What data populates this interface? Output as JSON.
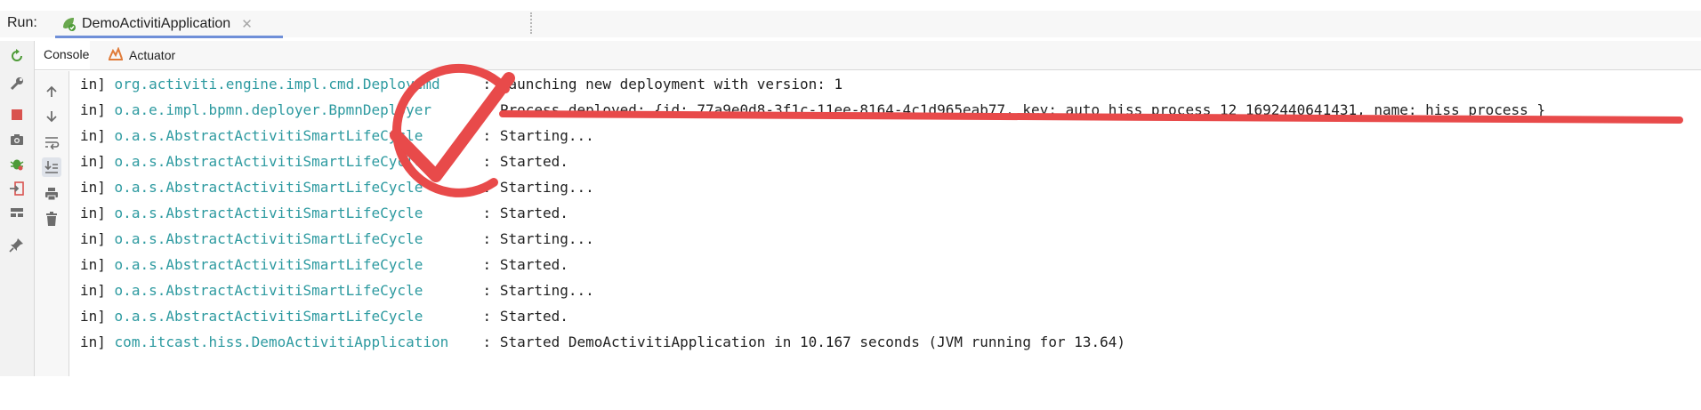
{
  "runbar": {
    "label": "Run:",
    "tab_title": "DemoActivitiApplication",
    "close_glyph": "✕"
  },
  "inner_tabs": [
    {
      "label": "Console",
      "icon": null
    },
    {
      "label": "Actuator",
      "icon": "actuator-icon"
    }
  ],
  "left_strip_icons": [
    "rerun-icon",
    "wrench-icon",
    "stop-icon",
    "camera-icon",
    "bug-icon",
    "exit-icon",
    "layout-icon",
    "pin-icon"
  ],
  "console_tools": [
    "arrow-up-icon",
    "arrow-down-icon",
    "soft-wrap-icon",
    "scroll-to-end-icon",
    "print-icon",
    "trash-icon"
  ],
  "console": {
    "lines": [
      {
        "level": "in]",
        "logger": "org.activiti.engine.impl.cmd.DeployCmd",
        "message": ": Launching new deployment with version: 1"
      },
      {
        "level": "in]",
        "logger": "o.a.e.impl.bpmn.deployer.BpmnDeployer",
        "message": ": Process deployed: {id: 77a9e0d8-3f1c-11ee-8164-4c1d965eab77, key: auto_hiss_process_12_1692440641431, name: hiss_process }"
      },
      {
        "level": "in]",
        "logger": "o.a.s.AbstractActivitiSmartLifeCycle",
        "message": ": Starting..."
      },
      {
        "level": "in]",
        "logger": "o.a.s.AbstractActivitiSmartLifeCycle",
        "message": ": Started."
      },
      {
        "level": "in]",
        "logger": "o.a.s.AbstractActivitiSmartLifeCycle",
        "message": ": Starting..."
      },
      {
        "level": "in]",
        "logger": "o.a.s.AbstractActivitiSmartLifeCycle",
        "message": ": Started."
      },
      {
        "level": "in]",
        "logger": "o.a.s.AbstractActivitiSmartLifeCycle",
        "message": ": Starting..."
      },
      {
        "level": "in]",
        "logger": "o.a.s.AbstractActivitiSmartLifeCycle",
        "message": ": Started."
      },
      {
        "level": "in]",
        "logger": "o.a.s.AbstractActivitiSmartLifeCycle",
        "message": ": Starting..."
      },
      {
        "level": "in]",
        "logger": "o.a.s.AbstractActivitiSmartLifeCycle",
        "message": ": Started."
      },
      {
        "level": "in]",
        "logger": "com.itcast.hiss.DemoActivitiApplication",
        "message": ": Started DemoActivitiApplication in 10.167 seconds (JVM running for 13.64)"
      }
    ]
  },
  "colors": {
    "logger_teal": "#2d9aa0",
    "annotation_red": "#e84a4a",
    "tab_underline": "#6f8fd8"
  }
}
